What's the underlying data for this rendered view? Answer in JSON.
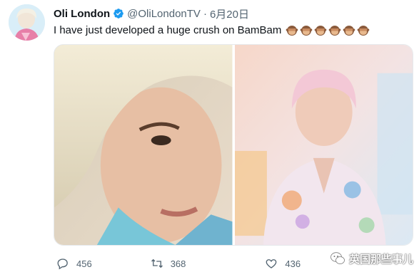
{
  "tweet": {
    "author": {
      "display_name": "Oli London",
      "handle": "@OliLondonTV",
      "separator": "·",
      "date": "6月20日",
      "verified_color": "#1d9bf0"
    },
    "text": "I have just developed a huge crush on BamBam",
    "emoji_count": 6,
    "emoji_name": "see-no-evil-monkey"
  },
  "actions": {
    "reply_count": "456",
    "retweet_count": "368",
    "like_count": "436",
    "icon_color": "#536471"
  },
  "watermark": {
    "text": "英国那些事儿"
  }
}
